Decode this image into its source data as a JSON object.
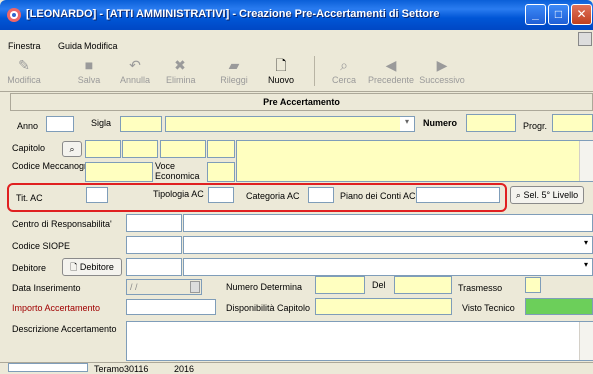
{
  "window": {
    "title": "[LEONARDO] - [ATTI AMMINISTRATIVI] - Creazione Pre-Accertamenti di Settore"
  },
  "menu": [
    "Finestra",
    "Guida",
    "Modifica"
  ],
  "toolbar": {
    "modifica": "Modifica",
    "salva": "Salva",
    "annulla": "Annulla",
    "elimina": "Elimina",
    "rileggi": "Rileggi",
    "nuovo": "Nuovo",
    "cerca": "Cerca",
    "precedente": "Precedente",
    "successivo": "Successivo"
  },
  "section_title": "Pre Accertamento",
  "form": {
    "anno": "Anno",
    "sigla": "Sigla",
    "numero": "Numero",
    "progr": "Progr.",
    "capitolo": "Capitolo",
    "codice_mecc": "Codice Meccanografico",
    "voce_economica": "Voce Economica",
    "tit_ac": "Tit. AC",
    "tipologia_ac": "Tipologia AC",
    "categoria_ac": "Categoria AC",
    "piano_conti": "Piano dei Conti AC",
    "sel_livello": "Sel. 5° Livello",
    "centro_resp": "Centro di Responsabilita'",
    "codice_siope": "Codice SIOPE",
    "debitore": "Debitore",
    "debitore_btn": "Debitore",
    "data_inserimento": "Data Inserimento",
    "data_value": "/ /",
    "numero_determina": "Numero Determina",
    "del": "Del",
    "trasmesso": "Trasmesso",
    "importo": "Importo Accertamento",
    "disponibilita": "Disponibilità Capitolo",
    "visto_tecnico": "Visto Tecnico",
    "descrizione": "Descrizione Accertamento"
  },
  "status": {
    "user": "Teramo30116",
    "year": "2016"
  },
  "colors": {
    "title": "#0a5fd8",
    "field": "#ffffc0",
    "highlight": "#e02020",
    "visto": "#6ccf5a",
    "importo_label": "#a00000"
  }
}
